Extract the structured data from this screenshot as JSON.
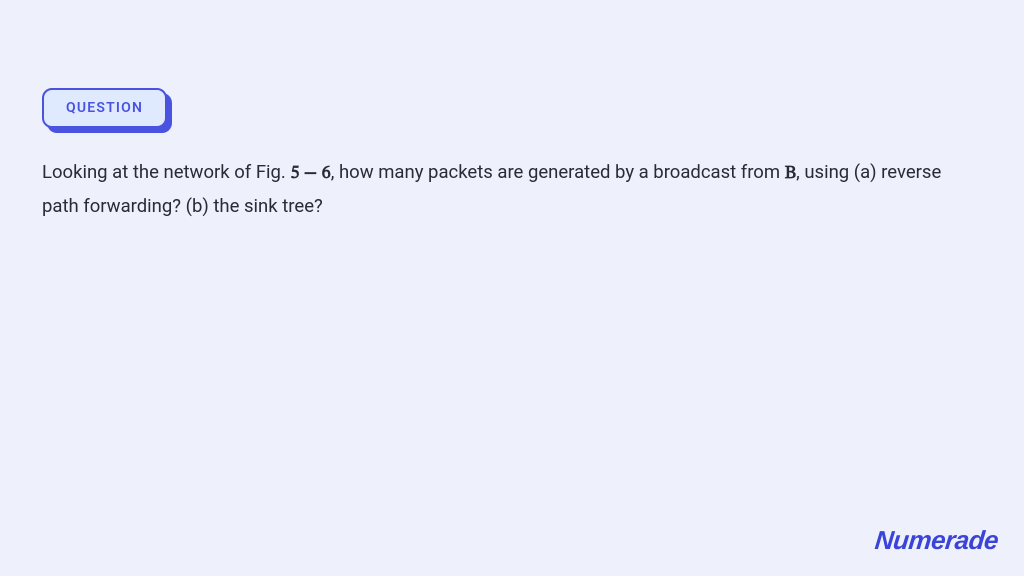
{
  "badge": {
    "label": "QUESTION"
  },
  "question": {
    "prefix": "Looking at the network of Fig. ",
    "fig_ref": "5 − 6",
    "mid": ", how many packets are generated by a broadcast from ",
    "node": "B",
    "suffix": ", using (a) reverse path forwarding? (b) the sink tree?"
  },
  "brand": {
    "name": "Numerade"
  }
}
